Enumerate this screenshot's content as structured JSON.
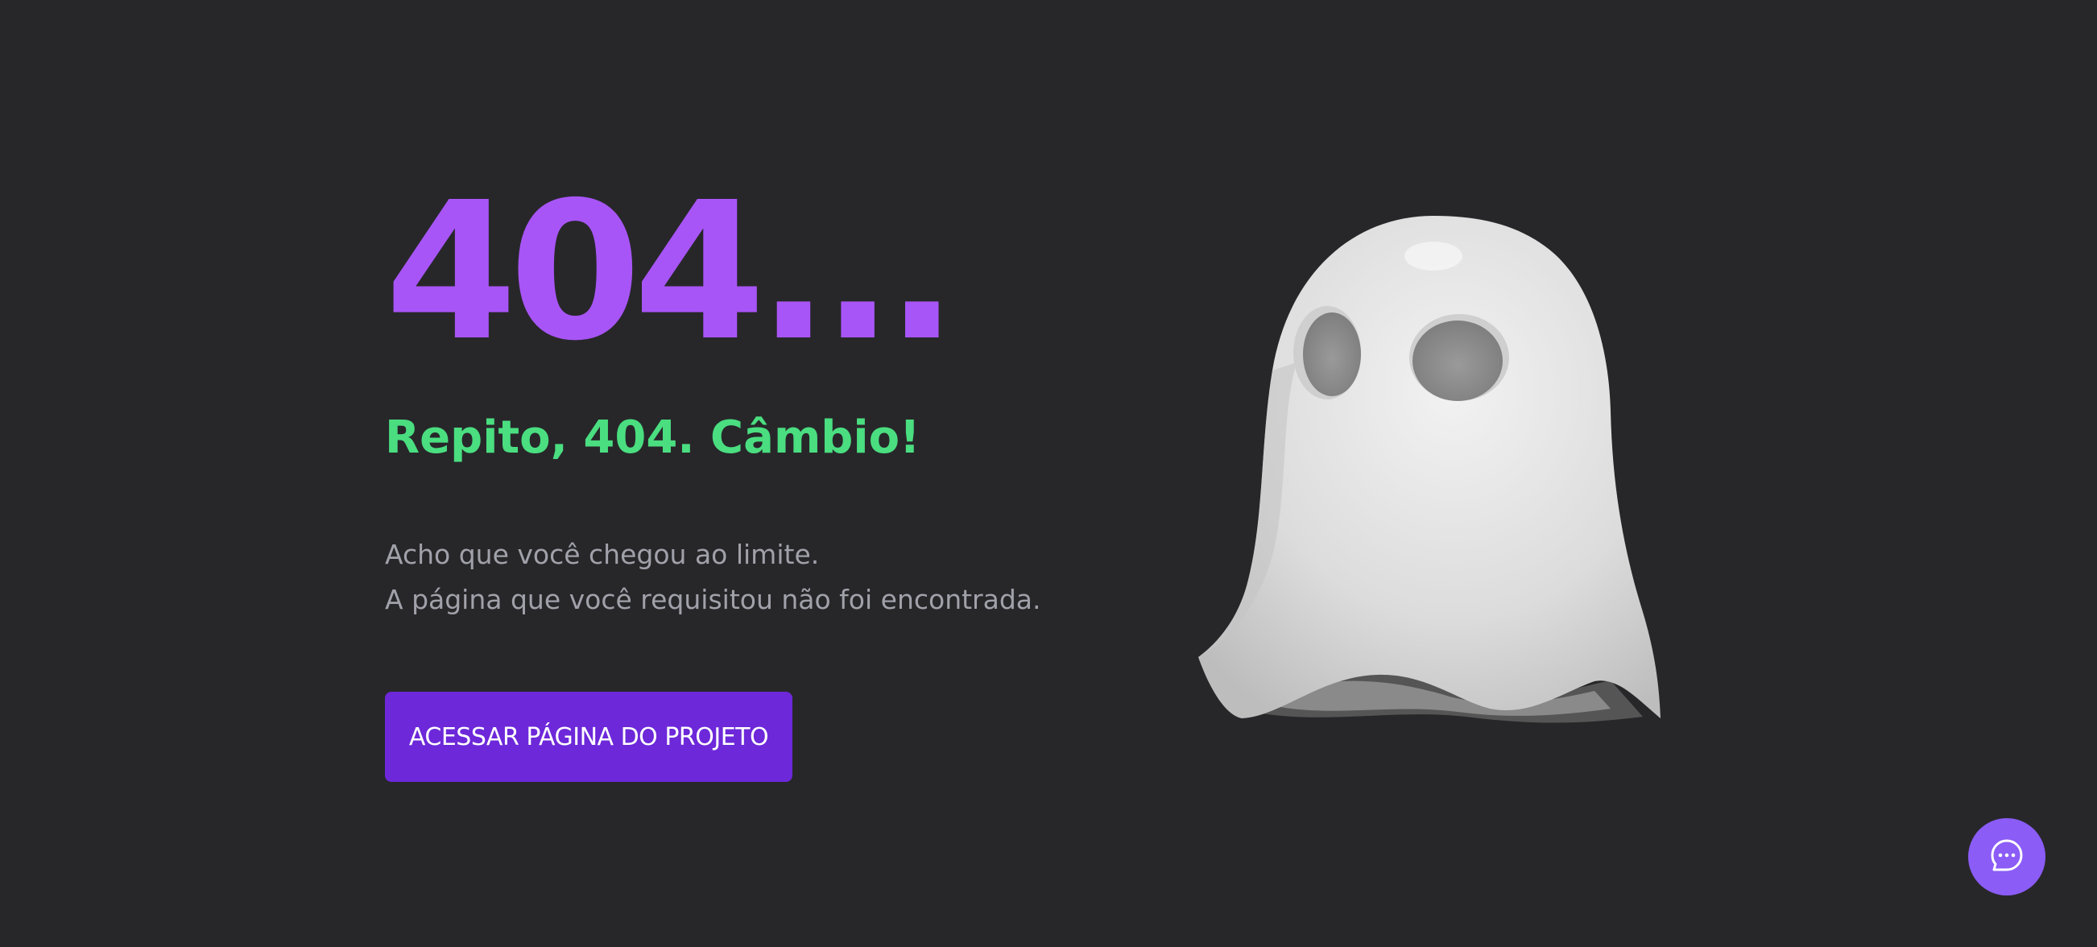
{
  "error": {
    "code": "404...",
    "subtitle": "Repito, 404. Câmbio!",
    "message_line1": "Acho que você chegou ao limite.",
    "message_line2": "A página que você requisitou não foi encontrada."
  },
  "actions": {
    "project_button_label": "ACESSAR PÁGINA DO PROJETO"
  },
  "illustration": {
    "icon": "ghost-illustration"
  },
  "chat": {
    "icon": "chat-bubble-icon"
  },
  "colors": {
    "background": "#27272a",
    "accent_purple": "#a855f7",
    "accent_green": "#4ade80",
    "button": "#6d28d9",
    "chat_fab": "#8b5cf6",
    "muted_text": "#a1a1aa"
  }
}
